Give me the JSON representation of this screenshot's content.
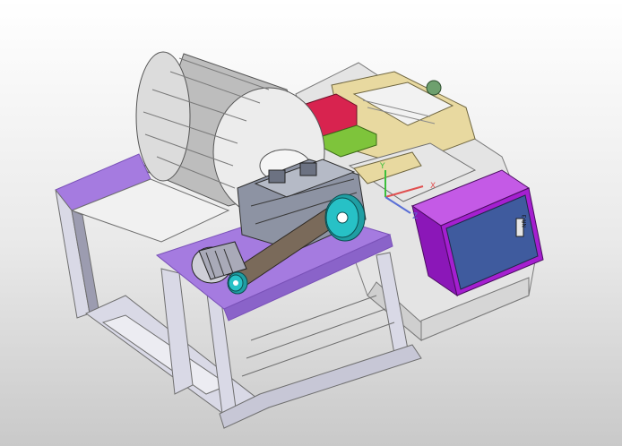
{
  "viewport": {
    "background_top": "#ffffff",
    "background_bottom": "#c9c9c9"
  },
  "colors": {
    "frame_top": "#a57be0",
    "frame_edge": "#7a52b8",
    "steel": "#d9d9e6",
    "steel_dark": "#9c9cb0",
    "gearbox": "#8d93a3",
    "pulley": "#27c1c6",
    "drum": "#ececec",
    "drum_shade": "#bdbdbd",
    "carriage": "#e8d9a0",
    "red_block": "#d8234f",
    "green_block": "#7ec43b",
    "panel_outer": "#a51fd0",
    "panel_face": "#3f5b9e",
    "triad_x": "#e05050",
    "triad_y": "#3bbf3b",
    "triad_z": "#5a6fd6"
  },
  "control_box": {
    "nameplate": "NR-3"
  },
  "triad": {
    "x_label": "X",
    "y_label": "Y",
    "z_label": "Z"
  }
}
